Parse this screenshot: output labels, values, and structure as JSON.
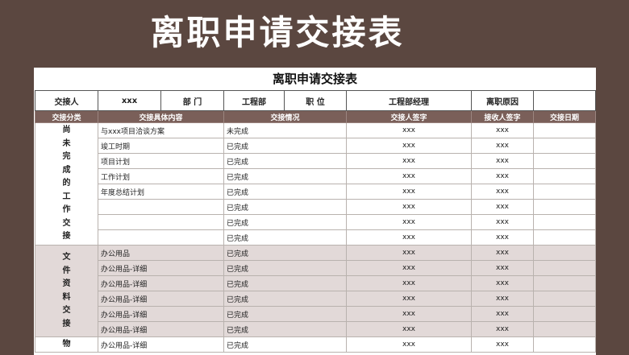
{
  "banner_title": "离职申请交接表",
  "sheet_title": "离职申请交接表",
  "info": {
    "handover_person_label": "交接人",
    "handover_person_value": "xxx",
    "department_label": "部 门",
    "department_value": "工程部",
    "position_label": "职 位",
    "position_value": "工程部经理",
    "reason_label": "离职原因",
    "reason_value": ""
  },
  "headers": {
    "category": "交接分类",
    "content": "交接具体内容",
    "status": "交接情况",
    "handover_sign": "交接人签字",
    "receiver_sign": "接收人签字",
    "date": "交接日期"
  },
  "groups": [
    {
      "category": "尚未完成的工作交接",
      "rows": [
        {
          "content": "与xxx项目洽谈方案",
          "status": "未完成",
          "sign1": "xxx",
          "sign2": "xxx",
          "date": ""
        },
        {
          "content": "竣工时期",
          "status": "已完成",
          "sign1": "xxx",
          "sign2": "xxx",
          "date": ""
        },
        {
          "content": "项目计划",
          "status": "已完成",
          "sign1": "xxx",
          "sign2": "xxx",
          "date": ""
        },
        {
          "content": "工作计划",
          "status": "已完成",
          "sign1": "xxx",
          "sign2": "xxx",
          "date": ""
        },
        {
          "content": "年度总结计划",
          "status": "已完成",
          "sign1": "xxx",
          "sign2": "xxx",
          "date": ""
        },
        {
          "content": "",
          "status": "已完成",
          "sign1": "xxx",
          "sign2": "xxx",
          "date": ""
        },
        {
          "content": "",
          "status": "已完成",
          "sign1": "xxx",
          "sign2": "xxx",
          "date": ""
        },
        {
          "content": "",
          "status": "已完成",
          "sign1": "xxx",
          "sign2": "xxx",
          "date": ""
        }
      ]
    },
    {
      "category": "文件资料交接",
      "rows": [
        {
          "content": "办公用品",
          "status": "已完成",
          "sign1": "xxx",
          "sign2": "xxx",
          "date": ""
        },
        {
          "content": "办公用品-详细",
          "status": "已完成",
          "sign1": "xxx",
          "sign2": "xxx",
          "date": ""
        },
        {
          "content": "办公用品-详细",
          "status": "已完成",
          "sign1": "xxx",
          "sign2": "xxx",
          "date": ""
        },
        {
          "content": "办公用品-详细",
          "status": "已完成",
          "sign1": "xxx",
          "sign2": "xxx",
          "date": ""
        },
        {
          "content": "办公用品-详细",
          "status": "已完成",
          "sign1": "xxx",
          "sign2": "xxx",
          "date": ""
        },
        {
          "content": "办公用品-详细",
          "status": "已完成",
          "sign1": "xxx",
          "sign2": "xxx",
          "date": ""
        }
      ]
    },
    {
      "category": "物",
      "rows": [
        {
          "content": "办公用品-详细",
          "status": "已完成",
          "sign1": "xxx",
          "sign2": "xxx",
          "date": ""
        }
      ]
    }
  ]
}
